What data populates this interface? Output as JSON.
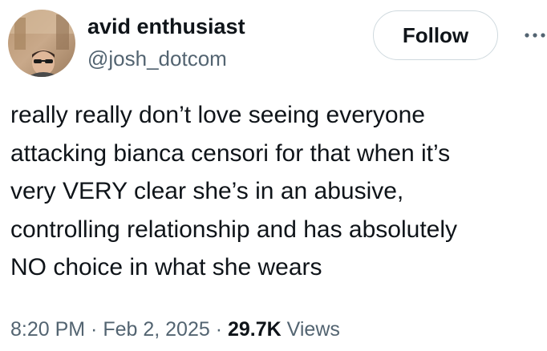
{
  "author": {
    "display_name": "avid enthusiast",
    "handle": "@josh_dotcom",
    "avatar_icon": "profile-photo"
  },
  "actions": {
    "follow_label": "Follow",
    "more_icon": "more-horizontal-icon"
  },
  "tweet": {
    "text": "really really don’t love seeing everyone\nattacking bianca censori for that when it’s\nvery VERY clear she’s in an abusive,\ncontrolling relationship and has absolutely\nNO choice in what she wears"
  },
  "meta": {
    "time": "8:20 PM",
    "separator_1": " · ",
    "date": "Feb 2, 2025",
    "separator_2": " · ",
    "views_count": "29.7K",
    "views_label": " Views"
  },
  "colors": {
    "primary_text": "#0f1419",
    "secondary_text": "#536471",
    "button_border": "#cfd9de"
  }
}
